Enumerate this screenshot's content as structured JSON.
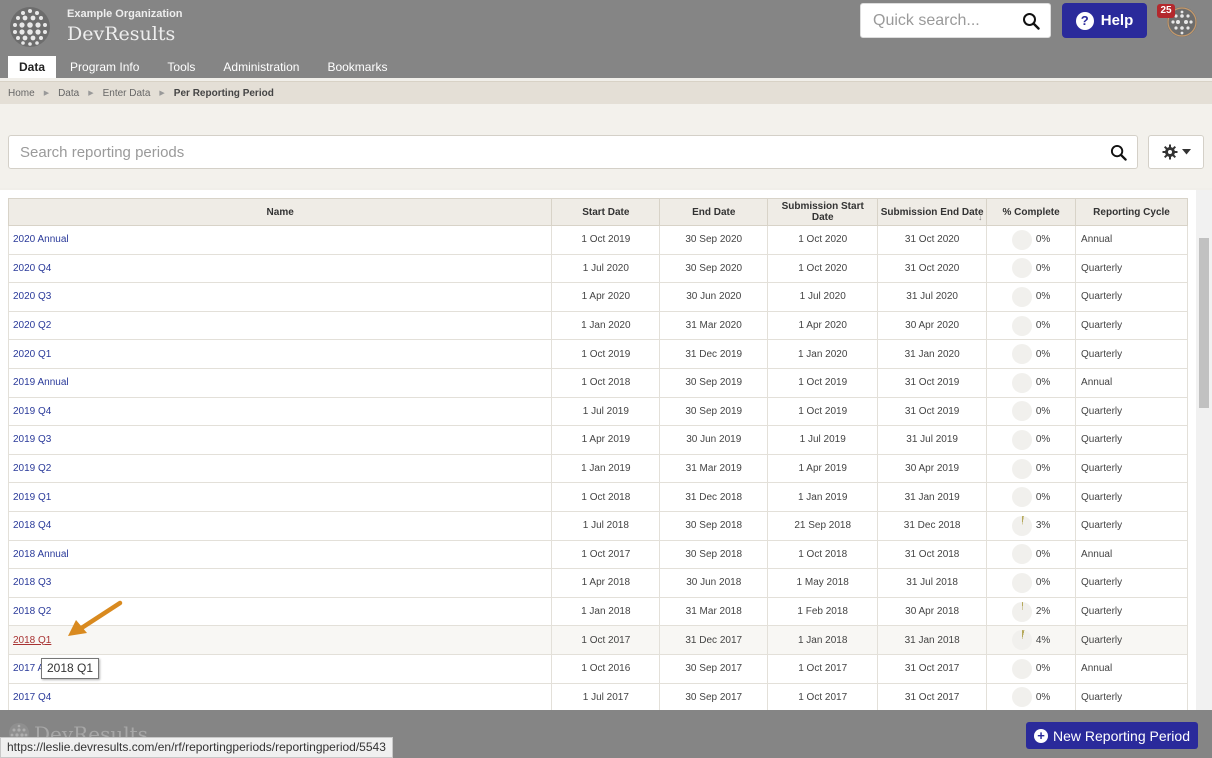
{
  "header": {
    "org_name": "Example Organization",
    "app_name": "DevResults",
    "quick_search_placeholder": "Quick search...",
    "help_label": "Help",
    "notification_count": "25"
  },
  "nav": {
    "tabs": [
      {
        "label": "Data",
        "active": true
      },
      {
        "label": "Program Info"
      },
      {
        "label": "Tools"
      },
      {
        "label": "Administration"
      },
      {
        "label": "Bookmarks"
      }
    ]
  },
  "breadcrumb": {
    "items": [
      "Home",
      "Data",
      "Enter Data"
    ],
    "current": "Per Reporting Period"
  },
  "filter": {
    "search_placeholder": "Search reporting periods"
  },
  "table": {
    "columns": [
      "Name",
      "Start Date",
      "End Date",
      "Submission Start Date",
      "Submission End Date",
      "% Complete",
      "Reporting Cycle"
    ],
    "sorted_column": "Submission End Date",
    "rows": [
      {
        "name": "2020 Annual",
        "start": "1 Oct 2019",
        "end": "30 Sep 2020",
        "sub_start": "1 Oct 2020",
        "sub_end": "31 Oct 2020",
        "pct": "0%",
        "cycle": "Annual"
      },
      {
        "name": "2020 Q4",
        "start": "1 Jul 2020",
        "end": "30 Sep 2020",
        "sub_start": "1 Oct 2020",
        "sub_end": "31 Oct 2020",
        "pct": "0%",
        "cycle": "Quarterly"
      },
      {
        "name": "2020 Q3",
        "start": "1 Apr 2020",
        "end": "30 Jun 2020",
        "sub_start": "1 Jul 2020",
        "sub_end": "31 Jul 2020",
        "pct": "0%",
        "cycle": "Quarterly"
      },
      {
        "name": "2020 Q2",
        "start": "1 Jan 2020",
        "end": "31 Mar 2020",
        "sub_start": "1 Apr 2020",
        "sub_end": "30 Apr 2020",
        "pct": "0%",
        "cycle": "Quarterly"
      },
      {
        "name": "2020 Q1",
        "start": "1 Oct 2019",
        "end": "31 Dec 2019",
        "sub_start": "1 Jan 2020",
        "sub_end": "31 Jan 2020",
        "pct": "0%",
        "cycle": "Quarterly"
      },
      {
        "name": "2019 Annual",
        "start": "1 Oct 2018",
        "end": "30 Sep 2019",
        "sub_start": "1 Oct 2019",
        "sub_end": "31 Oct 2019",
        "pct": "0%",
        "cycle": "Annual"
      },
      {
        "name": "2019 Q4",
        "start": "1 Jul 2019",
        "end": "30 Sep 2019",
        "sub_start": "1 Oct 2019",
        "sub_end": "31 Oct 2019",
        "pct": "0%",
        "cycle": "Quarterly"
      },
      {
        "name": "2019 Q3",
        "start": "1 Apr 2019",
        "end": "30 Jun 2019",
        "sub_start": "1 Jul 2019",
        "sub_end": "31 Jul 2019",
        "pct": "0%",
        "cycle": "Quarterly"
      },
      {
        "name": "2019 Q2",
        "start": "1 Jan 2019",
        "end": "31 Mar 2019",
        "sub_start": "1 Apr 2019",
        "sub_end": "30 Apr 2019",
        "pct": "0%",
        "cycle": "Quarterly"
      },
      {
        "name": "2019 Q1",
        "start": "1 Oct 2018",
        "end": "31 Dec 2018",
        "sub_start": "1 Jan 2019",
        "sub_end": "31 Jan 2019",
        "pct": "0%",
        "cycle": "Quarterly"
      },
      {
        "name": "2018 Q4",
        "start": "1 Jul 2018",
        "end": "30 Sep 2018",
        "sub_start": "21 Sep 2018",
        "sub_end": "31 Dec 2018",
        "pct": "3%",
        "cycle": "Quarterly"
      },
      {
        "name": "2018 Annual",
        "start": "1 Oct 2017",
        "end": "30 Sep 2018",
        "sub_start": "1 Oct 2018",
        "sub_end": "31 Oct 2018",
        "pct": "0%",
        "cycle": "Annual"
      },
      {
        "name": "2018 Q3",
        "start": "1 Apr 2018",
        "end": "30 Jun 2018",
        "sub_start": "1 May 2018",
        "sub_end": "31 Jul 2018",
        "pct": "0%",
        "cycle": "Quarterly"
      },
      {
        "name": "2018 Q2",
        "start": "1 Jan 2018",
        "end": "31 Mar 2018",
        "sub_start": "1 Feb 2018",
        "sub_end": "30 Apr 2018",
        "pct": "2%",
        "cycle": "Quarterly"
      },
      {
        "name": "2018 Q1",
        "start": "1 Oct 2017",
        "end": "31 Dec 2017",
        "sub_start": "1 Jan 2018",
        "sub_end": "31 Jan 2018",
        "pct": "4%",
        "cycle": "Quarterly",
        "hovered": true
      },
      {
        "name": "2017 Annual",
        "start": "1 Oct 2016",
        "end": "30 Sep 2017",
        "sub_start": "1 Oct 2017",
        "sub_end": "31 Oct 2017",
        "pct": "0%",
        "cycle": "Annual"
      },
      {
        "name": "2017 Q4",
        "start": "1 Jul 2017",
        "end": "30 Sep 2017",
        "sub_start": "1 Oct 2017",
        "sub_end": "31 Oct 2017",
        "pct": "0%",
        "cycle": "Quarterly"
      }
    ]
  },
  "tooltip": {
    "text": "2018 Q1"
  },
  "footer": {
    "brand": "DevResults",
    "new_period_label": "New Reporting Period"
  },
  "status_bar": {
    "url": "https://leslie.devresults.com/en/rf/reportingperiods/reportingperiod/5543"
  },
  "colors": {
    "header_bg": "#858585",
    "primary_button": "#2a2a9b",
    "link": "#2a3a9a",
    "hover_link": "#a83232",
    "annotation_arrow": "#d98a1f",
    "badge": "#b3282d"
  }
}
